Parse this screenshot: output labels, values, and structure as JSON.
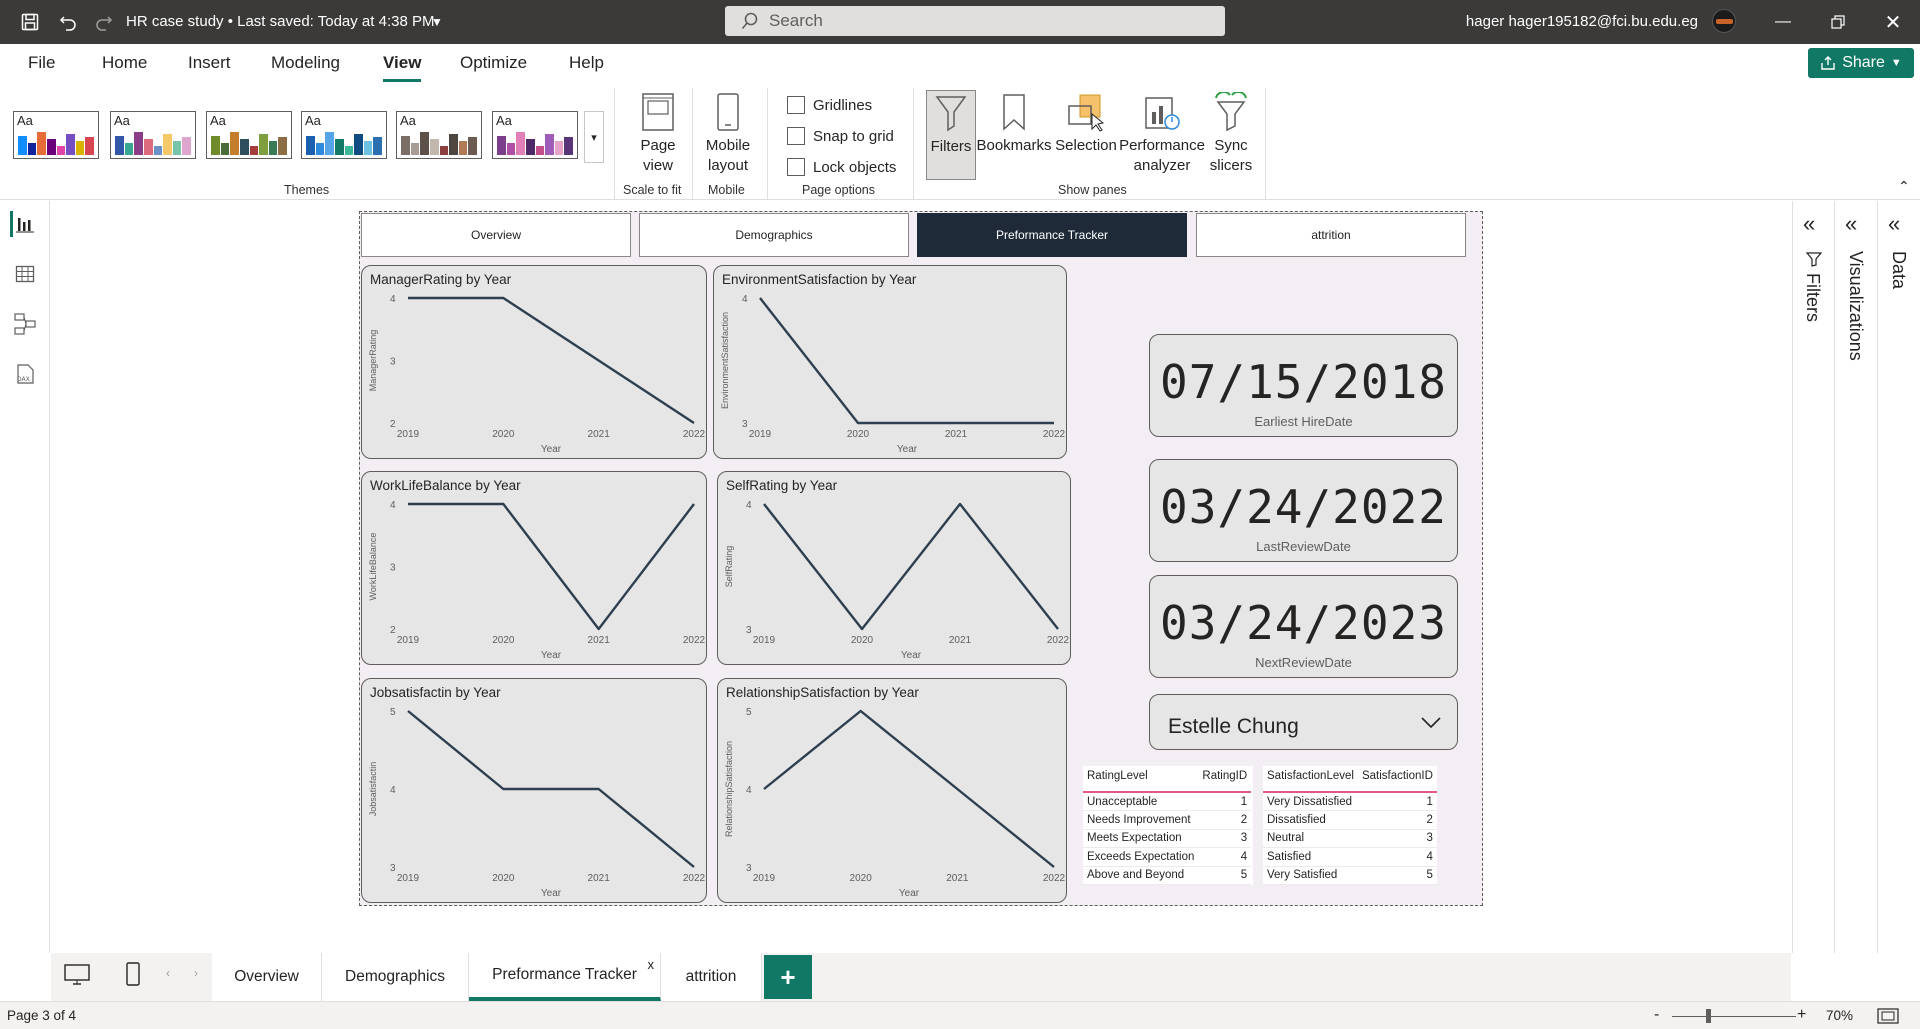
{
  "titlebar": {
    "doc_title": "HR case study • Last saved: Today at 4:38 PM",
    "search_placeholder": "Search",
    "user": "hager hager195182@fci.bu.edu.eg"
  },
  "menu": [
    "File",
    "Home",
    "Insert",
    "Modeling",
    "View",
    "Optimize",
    "Help"
  ],
  "active_menu": "View",
  "share_label": "Share",
  "ribbon": {
    "themes_label": "Themes",
    "theme_palettes": [
      [
        "#118dff",
        "#12239e",
        "#e66c37",
        "#6b007b",
        "#e044a7",
        "#744ec2",
        "#d9b300",
        "#d64550"
      ],
      [
        "#3257a8",
        "#37a794",
        "#8b3d88",
        "#dd6b7f",
        "#6b91c9",
        "#f5c869",
        "#77c4a8",
        "#dea6cf"
      ],
      [
        "#6f8b2c",
        "#4c6b3a",
        "#c47d2a",
        "#2f4e5b",
        "#a63b3b",
        "#7e9e3f",
        "#3b7a57",
        "#8c6d46"
      ],
      [
        "#1b5fb1",
        "#2e8ade",
        "#56a4e8",
        "#147a66",
        "#3db89b",
        "#0f4c81",
        "#6cc1e0",
        "#2a6fb0"
      ],
      [
        "#7a6e66",
        "#a89d94",
        "#5e514a",
        "#c2b8ae",
        "#8c3f3f",
        "#4d4540",
        "#b07a56",
        "#6b5b50"
      ],
      [
        "#7c3f8c",
        "#b04fa6",
        "#e27fb9",
        "#4e2a6b",
        "#c44e8a",
        "#9f5cb8",
        "#e6a4c9",
        "#5a3578"
      ]
    ],
    "page_view": "Page view",
    "mobile_layout": "Mobile layout",
    "scale_to_fit": "Scale to fit",
    "mobile": "Mobile",
    "gridlines": "Gridlines",
    "snap_to_grid": "Snap to grid",
    "lock_objects": "Lock objects",
    "page_options": "Page options",
    "filters": "Filters",
    "bookmarks": "Bookmarks",
    "selection": "Selection",
    "performance_analyzer": "Performance analyzer",
    "sync_slicers": "Sync slicers",
    "show_panes": "Show panes"
  },
  "panes": {
    "filters": "Filters",
    "visualizations": "Visualizations",
    "data": "Data"
  },
  "report_nav": [
    "Overview",
    "Demographics",
    "Preformance Tracker",
    "attrition"
  ],
  "active_nav": "Preformance Tracker",
  "cards": [
    {
      "value": "07/15/2018",
      "label": "Earliest HireDate"
    },
    {
      "value": "03/24/2022",
      "label": "LastReviewDate"
    },
    {
      "value": "03/24/2023",
      "label": "NextReviewDate"
    }
  ],
  "slicer_value": "Estelle Chung",
  "rating_table": {
    "headers": [
      "RatingLevel",
      "RatingID"
    ],
    "rows": [
      [
        "Unacceptable",
        "1"
      ],
      [
        "Needs Improvement",
        "2"
      ],
      [
        "Meets Expectation",
        "3"
      ],
      [
        "Exceeds Expectation",
        "4"
      ],
      [
        "Above and Beyond",
        "5"
      ]
    ]
  },
  "satisfaction_table": {
    "headers": [
      "SatisfactionLevel",
      "SatisfactionID"
    ],
    "rows": [
      [
        "Very Dissatisfied",
        "1"
      ],
      [
        "Dissatisfied",
        "2"
      ],
      [
        "Neutral",
        "3"
      ],
      [
        "Satisfied",
        "4"
      ],
      [
        "Very Satisfied",
        "5"
      ]
    ]
  },
  "page_tabs": [
    "Overview",
    "Demographics",
    "Preformance Tracker",
    "attrition"
  ],
  "active_page_tab": "Preformance Tracker",
  "status": {
    "page": "Page 3 of 4",
    "zoom": "70%"
  },
  "line_color": "#2e3f4f",
  "chart_data": [
    {
      "type": "line",
      "title": "ManagerRating by Year",
      "xlabel": "Year",
      "ylabel": "ManagerRating",
      "x": [
        "2019",
        "2020",
        "2021",
        "2022"
      ],
      "y": [
        4,
        4,
        3,
        2
      ],
      "yticks": [
        "2",
        "3",
        "4"
      ],
      "ylim": [
        2,
        4
      ]
    },
    {
      "type": "line",
      "title": "EnvironmentSatisfaction by Year",
      "xlabel": "Year",
      "ylabel": "EnvironmentSatisfaction",
      "x": [
        "2019",
        "2020",
        "2021",
        "2022"
      ],
      "y": [
        4,
        3,
        3,
        3
      ],
      "yticks": [
        "3",
        "4"
      ],
      "ylim": [
        3,
        4
      ]
    },
    {
      "type": "line",
      "title": "WorkLifeBalance by Year",
      "xlabel": "Year",
      "ylabel": "WorkLifeBalance",
      "x": [
        "2019",
        "2020",
        "2021",
        "2022"
      ],
      "y": [
        4,
        4,
        2,
        4
      ],
      "yticks": [
        "2",
        "3",
        "4"
      ],
      "ylim": [
        2,
        4
      ]
    },
    {
      "type": "line",
      "title": "SelfRating by Year",
      "xlabel": "Year",
      "ylabel": "SelfRating",
      "x": [
        "2019",
        "2020",
        "2021",
        "2022"
      ],
      "y": [
        4,
        3,
        4,
        3
      ],
      "yticks": [
        "3",
        "4"
      ],
      "ylim": [
        3,
        4
      ]
    },
    {
      "type": "line",
      "title": "Jobsatisfactin by Year",
      "xlabel": "Year",
      "ylabel": "Jobsatisfactin",
      "x": [
        "2019",
        "2020",
        "2021",
        "2022"
      ],
      "y": [
        5,
        4,
        4,
        3
      ],
      "yticks": [
        "3",
        "4",
        "5"
      ],
      "ylim": [
        3,
        5
      ]
    },
    {
      "type": "line",
      "title": "RelationshipSatisfaction by Year",
      "xlabel": "Year",
      "ylabel": "RelationshipSatisfaction",
      "x": [
        "2019",
        "2020",
        "2021",
        "2022"
      ],
      "y": [
        4,
        5,
        4,
        3
      ],
      "yticks": [
        "3",
        "4",
        "5"
      ],
      "ylim": [
        3,
        5
      ]
    }
  ]
}
